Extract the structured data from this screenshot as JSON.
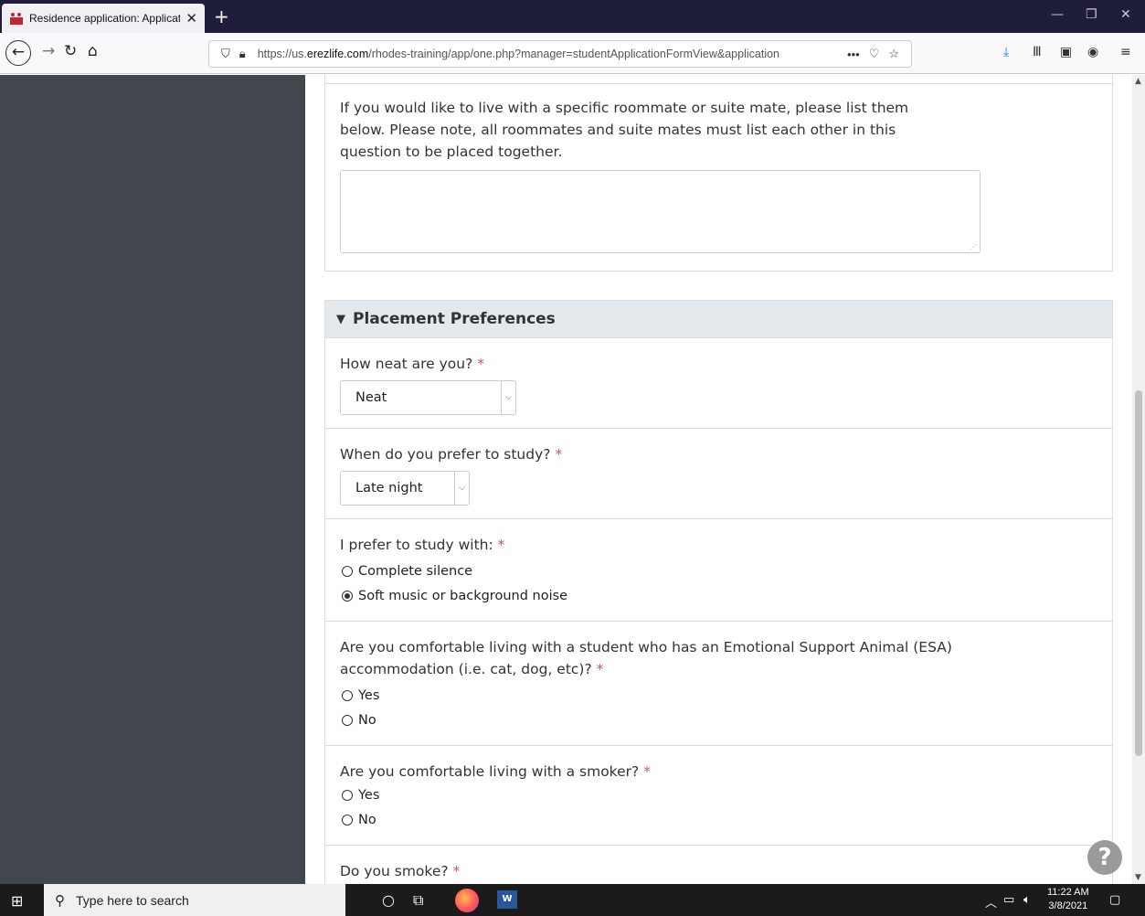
{
  "browser": {
    "tab_title": "Residence application: Applicat",
    "tab_close": "✕",
    "new_tab": "+",
    "url_prefix": "https://us.",
    "url_domain": "erezlife.com",
    "url_rest": "/rhodes-training/app/one.php?manager=studentApplicationFormView&application",
    "url_more": "•••"
  },
  "roommate_question": {
    "text": "If you would like to live with a specific roommate or suite mate, please list them below. Please note, all roommates and suite mates must list each other in this question to be placed together.",
    "value": ""
  },
  "section": {
    "title": "Placement Preferences",
    "toggle": "▼"
  },
  "questions": {
    "neat": {
      "label": "How neat are you?",
      "required": "*",
      "selected": "Neat"
    },
    "study_time": {
      "label": "When do you prefer to study?",
      "required": "*",
      "selected": "Late night"
    },
    "study_with": {
      "label": "I prefer to study with:",
      "required": "*",
      "options": [
        "Complete silence",
        "Soft music or background noise"
      ],
      "selected": "Soft music or background noise"
    },
    "esa": {
      "label": "Are you comfortable living with a student who has an Emotional Support Animal (ESA) accommodation (i.e. cat, dog, etc)?",
      "required": "*",
      "options": [
        "Yes",
        "No"
      ]
    },
    "smoker": {
      "label": "Are you comfortable living with a smoker?",
      "required": "*",
      "options": [
        "Yes",
        "No"
      ]
    },
    "do_you_smoke": {
      "label": "Do you smoke?",
      "required": "*"
    }
  },
  "help_button": "?",
  "taskbar": {
    "search_placeholder": "Type here to search",
    "time": "11:22 AM",
    "date": "3/8/2021"
  },
  "colors": {
    "sidebar": "#42474e",
    "section_header_bg": "#e3e9ec",
    "required": "#d9534f",
    "title_bar": "#1f1e3a"
  }
}
